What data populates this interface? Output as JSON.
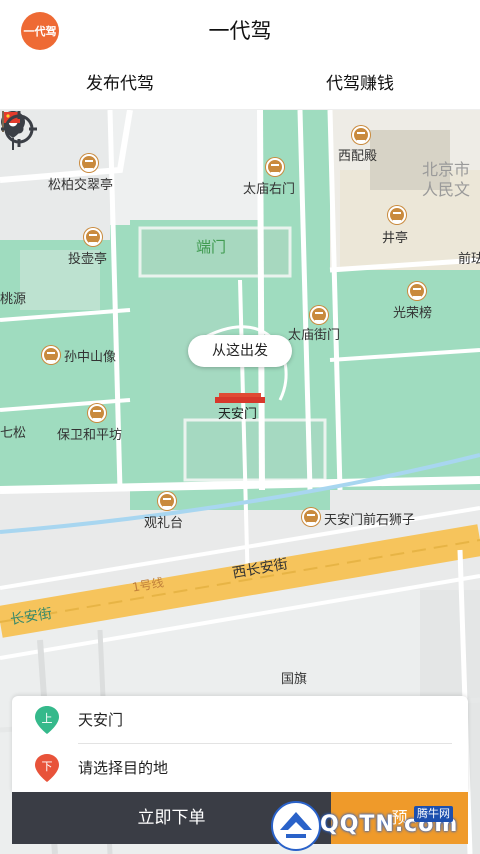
{
  "header": {
    "logo_text": "一代驾",
    "title": "一代驾",
    "logo_color": "#ee6a34"
  },
  "tabs": [
    {
      "label": "发布代驾"
    },
    {
      "label": "代驾赚钱"
    }
  ],
  "map": {
    "pois": [
      {
        "label": "松柏交翠亭"
      },
      {
        "label": "太庙右门"
      },
      {
        "label": "西配殿"
      },
      {
        "label": "投壶亭"
      },
      {
        "label": "井亭"
      },
      {
        "label": "桃源"
      },
      {
        "label": "光荣榜"
      },
      {
        "label": "太庙街门"
      },
      {
        "label": "孙中山像"
      },
      {
        "label": "七松"
      },
      {
        "label": "保卫和平坊"
      },
      {
        "label": "观礼台"
      },
      {
        "label": "天安门前石狮子"
      },
      {
        "label": "国旗"
      }
    ],
    "area_labels": {
      "duanmen": "端门",
      "beijing_top": "北京市",
      "beijing_bottom": "人民文",
      "qiantai": "前珐"
    },
    "roads": {
      "xichanganjie": "西长安街",
      "changanjie": "长安街",
      "line1": "1号线"
    },
    "start_bubble": "从这出发",
    "pin_label": "天安门",
    "icons": {
      "pin": "map-pin-icon",
      "locate": "locate-crosshair-icon",
      "flag": "flag-icon"
    }
  },
  "panel": {
    "pickup_mark": "上",
    "pickup_address": "天安门",
    "dropoff_mark": "下",
    "dropoff_placeholder": "请选择目的地",
    "pickup_color": "#35b98b",
    "dropoff_color": "#e8533a"
  },
  "actions": {
    "order_label": "立即下单",
    "reserve_label": "预",
    "order_color": "#3a3d45",
    "reserve_color": "#ef9a2a"
  },
  "watermark": {
    "text": "QQTN.com",
    "tag": "腾牛网"
  }
}
